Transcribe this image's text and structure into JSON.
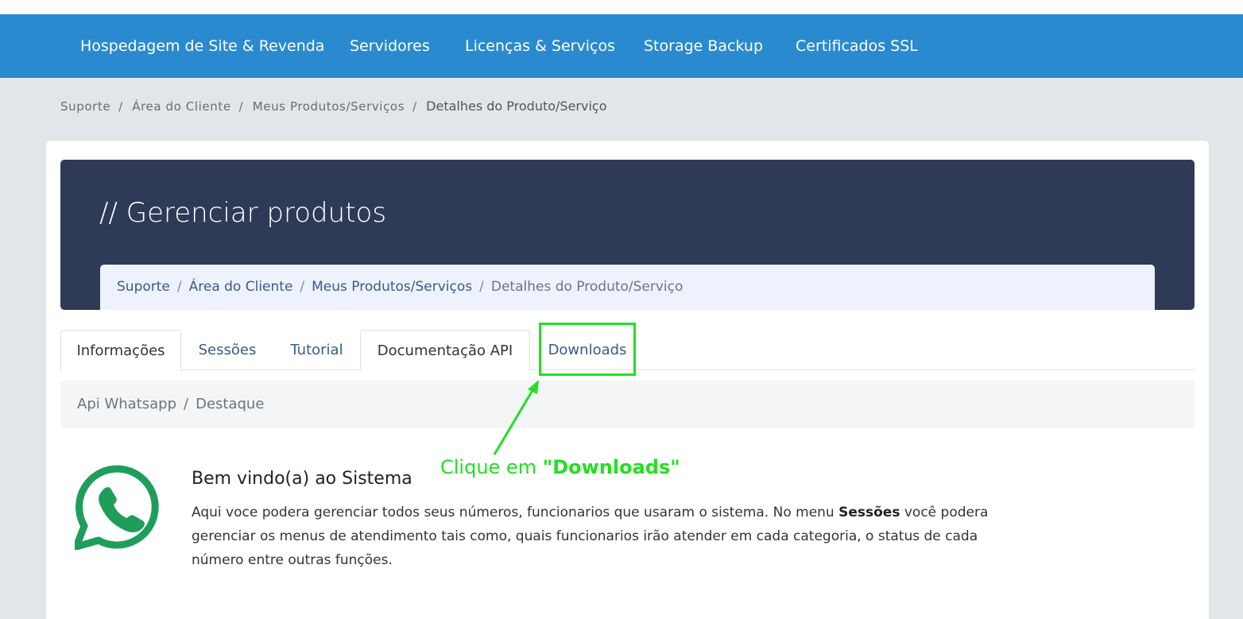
{
  "navbar": {
    "items": [
      {
        "label": "Hospedagem de Site & Revenda"
      },
      {
        "label": "Servidores"
      },
      {
        "label": "Licenças & Serviços"
      },
      {
        "label": "Storage Backup"
      },
      {
        "label": "Certificados SSL"
      }
    ],
    "background": "#2a8ad0"
  },
  "outer_breadcrumb": {
    "items": [
      "Suporte",
      "Área do Cliente",
      "Meus Produtos/Serviços"
    ],
    "current": "Detalhes do Produto/Serviço",
    "separator": "/"
  },
  "hero": {
    "title": "// Gerenciar produtos",
    "background": "#2f3b56",
    "breadcrumb": {
      "items": [
        "Suporte",
        "Área do Cliente",
        "Meus Produtos/Serviços"
      ],
      "current": "Detalhes do Produto/Serviço",
      "separator": "/"
    }
  },
  "tabs": [
    {
      "label": "Informações",
      "active": true
    },
    {
      "label": "Sessões"
    },
    {
      "label": "Tutorial"
    },
    {
      "label": "Documentação API"
    },
    {
      "label": "Downloads",
      "highlighted": true
    }
  ],
  "sub_breadcrumb": {
    "items": [
      "Api Whatsapp"
    ],
    "current": "Destaque",
    "separator": "/"
  },
  "annotation": {
    "prefix": "Clique em ",
    "emphasis": "\"Downloads\"",
    "color": "#22e022"
  },
  "welcome": {
    "icon": "whatsapp-icon",
    "icon_color": "#1e9e5a",
    "title": "Bem vindo(a) ao Sistema",
    "text_before": "Aqui voce podera gerenciar todos seus números, funcionarios que usaram o sistema. No menu ",
    "text_bold": "Sessões",
    "text_after": " você podera gerenciar os menus de atendimento tais como, quais funcionarios irão atender em cada categoria, o status de cada número entre outras funções."
  }
}
